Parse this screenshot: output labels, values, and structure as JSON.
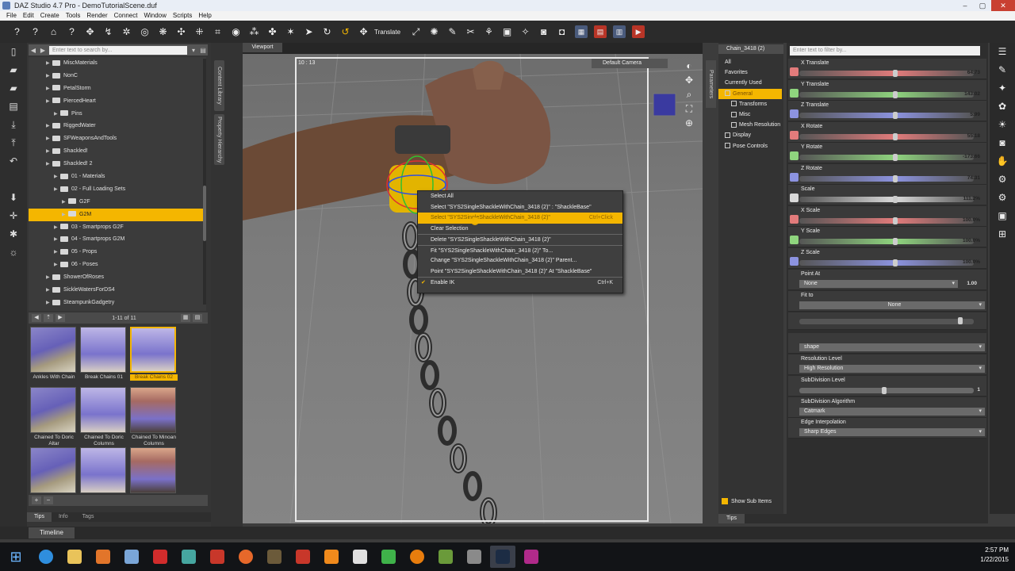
{
  "window": {
    "title": "DAZ Studio 4.7 Pro - DemoTutorialScene.duf",
    "controls": [
      "–",
      "▢",
      "✕"
    ]
  },
  "menu": [
    "File",
    "Edit",
    "Create",
    "Tools",
    "Render",
    "Connect",
    "Window",
    "Scripts",
    "Help"
  ],
  "toolbar": {
    "translate_label": "Translate"
  },
  "content_library": {
    "search_placeholder": "Enter text to search by...",
    "tab_vertical": "Content Library",
    "tab_vertical2": "Property Hierarchy",
    "tree": [
      {
        "label": "MiscMaterials",
        "indent": 2
      },
      {
        "label": "NonC",
        "indent": 2
      },
      {
        "label": "PetalStorm",
        "indent": 2
      },
      {
        "label": "PiercedHeart",
        "indent": 2
      },
      {
        "label": "Pins",
        "indent": 3
      },
      {
        "label": "RiggedWater",
        "indent": 2
      },
      {
        "label": "SFWeaponsAndTools",
        "indent": 2
      },
      {
        "label": "Shackled!",
        "indent": 2
      },
      {
        "label": "Shackled! 2",
        "indent": 2
      },
      {
        "label": "01 - Materials",
        "indent": 3
      },
      {
        "label": "02 - Full Loading Sets",
        "indent": 3
      },
      {
        "label": "G2F",
        "indent": 4
      },
      {
        "label": "G2M",
        "indent": 4,
        "selected": true
      },
      {
        "label": "03 - Smartprops G2F",
        "indent": 3
      },
      {
        "label": "04 - Smartprops G2M",
        "indent": 3
      },
      {
        "label": "05 - Props",
        "indent": 3
      },
      {
        "label": "06 - Poses",
        "indent": 3
      },
      {
        "label": "ShowerOfRoses",
        "indent": 2
      },
      {
        "label": "SickleWatersForDS4",
        "indent": 2
      },
      {
        "label": "SteampunkGadgetry",
        "indent": 2
      }
    ],
    "count": "1-11 of 11",
    "thumbs": [
      {
        "caption": "Ankles With Chain"
      },
      {
        "caption": "Break Chains 01"
      },
      {
        "caption": "Break Chains 02",
        "selected": true
      },
      {
        "caption": "Chained To Doric Altar"
      },
      {
        "caption": "Chained To Doric Columns"
      },
      {
        "caption": "Chained To Minoan Columns"
      },
      {
        "caption": ""
      },
      {
        "caption": ""
      },
      {
        "caption": ""
      }
    ],
    "bottom_tabs": [
      "Tips",
      "Info",
      "Tags"
    ]
  },
  "viewport": {
    "tab": "Viewport",
    "fps": "10 : 13",
    "camera": "Default Camera",
    "context_menu": [
      {
        "label": "Select All",
        "shortcut": ""
      },
      {
        "label": "Select \"SYS2SingleShackleWithChain_3418 (2)\" : \"ShackleBase\"",
        "shortcut": ""
      },
      {
        "label": "Select \"SYS2SingleShackleWithChain_3418 (2)\"",
        "shortcut": "Ctrl+Click",
        "highlight": true
      },
      {
        "label": "Clear Selection",
        "shortcut": ""
      },
      {
        "label": "Delete \"SYS2SingleShackleWithChain_3418 (2)\"",
        "shortcut": "",
        "sep": true
      },
      {
        "label": "Fit \"SYS2SingleShackleWithChain_3418 (2)\" To...",
        "shortcut": "",
        "sep": true
      },
      {
        "label": "Change \"SYS2SingleShackleWithChain_3418 (2)\" Parent...",
        "shortcut": ""
      },
      {
        "label": "Point \"SYS2SingleShackleWithChain_3418 (2)\" At \"ShackleBase\"",
        "shortcut": ""
      },
      {
        "label": "Enable IK",
        "shortcut": "Ctrl+K",
        "sep": true,
        "check": true
      }
    ]
  },
  "parameters": {
    "node_select": "Chain_3418 (2)",
    "filter_placeholder": "Enter text to filter by...",
    "tab_vertical": "Parameters",
    "categories": [
      {
        "label": "All",
        "indent": 0
      },
      {
        "label": "Favorites",
        "indent": 0
      },
      {
        "label": "Currently Used",
        "indent": 0
      },
      {
        "label": "General",
        "indent": 0,
        "selected": true
      },
      {
        "label": "Transforms",
        "indent": 1
      },
      {
        "label": "Misc",
        "indent": 1
      },
      {
        "label": "Mesh Resolution",
        "indent": 1
      },
      {
        "label": "Display",
        "indent": 0
      },
      {
        "label": "Pose Controls",
        "indent": 0
      }
    ],
    "show_sub_items": "Show Sub Items",
    "rows": [
      {
        "label": "X Translate",
        "value": "64.73",
        "color": "#e27b7b",
        "knob": 0.55
      },
      {
        "label": "Y Translate",
        "value": "143.02",
        "color": "#8fd57e",
        "knob": 0.55
      },
      {
        "label": "Z Translate",
        "value": "5.99",
        "color": "#8c93e0",
        "knob": 0.55
      },
      {
        "label": "X Rotate",
        "value": "55.18",
        "color": "#e27b7b",
        "knob": 0.55
      },
      {
        "label": "Y Rotate",
        "value": "-173.66",
        "color": "#8fd57e",
        "knob": 0.55
      },
      {
        "label": "Z Rotate",
        "value": "74.31",
        "color": "#8c93e0",
        "knob": 0.55
      },
      {
        "label": "Scale",
        "value": "111.2%",
        "color": "#d9d9d9",
        "knob": 0.55
      },
      {
        "label": "X Scale",
        "value": "100.0%",
        "color": "#e27b7b",
        "knob": 0.55
      },
      {
        "label": "Y Scale",
        "value": "100.0%",
        "color": "#8fd57e",
        "knob": 0.55
      },
      {
        "label": "Z Scale",
        "value": "100.0%",
        "color": "#8c93e0",
        "knob": 0.55
      }
    ],
    "point_at": {
      "label": "Point At",
      "value": "None",
      "num": "1.00"
    },
    "fit_to": {
      "label": "Fit to",
      "value": "None"
    },
    "shape_value": "shape",
    "resolution": {
      "label": "Resolution Level",
      "value": "High Resolution"
    },
    "subdiv": {
      "label": "SubDivision Level",
      "value": "1"
    },
    "algo": {
      "label": "SubDivision Algorithm",
      "value": "Catmark"
    },
    "edge": {
      "label": "Edge Interpolation",
      "value": "Sharp Edges"
    },
    "tips_tab": "Tips"
  },
  "timeline": "Timeline",
  "taskbar": {
    "time": "2:57 PM",
    "date": "1/22/2015"
  },
  "colors": {
    "accent": "#f4b600",
    "panel": "#353535"
  }
}
